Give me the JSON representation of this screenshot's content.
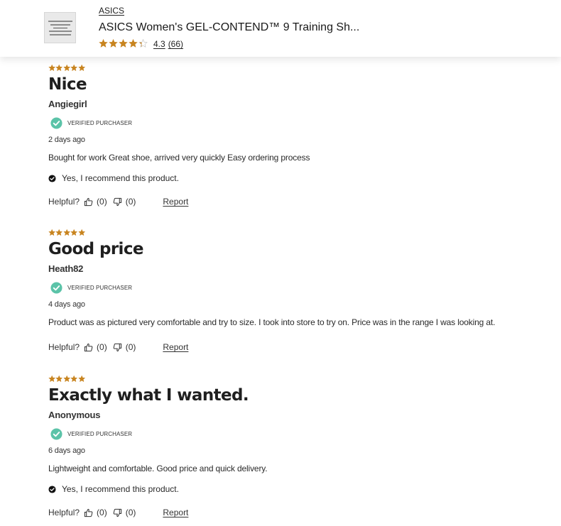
{
  "colors": {
    "star": "#c8841f",
    "verified_badge": "#5bc3a8",
    "text": "#1a1a1a"
  },
  "header": {
    "thumbnail_icon": "product-image-placeholder-icon",
    "brand": "ASICS",
    "title": "ASICS Women's GEL-CONTEND™ 9 Training Sh...",
    "rating": "4.3",
    "rating_value": 4.3,
    "review_count": "(66)"
  },
  "reviews": [
    {
      "rating_value": 5,
      "title": "Nice",
      "author": "Angiegirl",
      "verified_label": "VERIFIED PURCHASER",
      "date": "2 days ago",
      "body": "Bought for work Great shoe, arrived very quickly Easy ordering process",
      "recommend": "Yes, I recommend this product.",
      "helpful_label": "Helpful?",
      "helpful_yes": "(0)",
      "helpful_no": "(0)",
      "report_label": "Report"
    },
    {
      "rating_value": 5,
      "title": "Good price",
      "author": "Heath82",
      "verified_label": "VERIFIED PURCHASER",
      "date": "4 days ago",
      "body": "Product was as pictured very comfortable and try to size. I took into store to try on. Price was in the range I was looking at.",
      "recommend": null,
      "helpful_label": "Helpful?",
      "helpful_yes": "(0)",
      "helpful_no": "(0)",
      "report_label": "Report"
    },
    {
      "rating_value": 5,
      "title": "Exactly what I wanted.",
      "author": "Anonymous",
      "verified_label": "VERIFIED PURCHASER",
      "date": "6 days ago",
      "body": "Lightweight and comfortable. Good price and quick delivery.",
      "recommend": "Yes, I recommend this product.",
      "helpful_label": "Helpful?",
      "helpful_yes": "(0)",
      "helpful_no": "(0)",
      "report_label": "Report"
    }
  ]
}
